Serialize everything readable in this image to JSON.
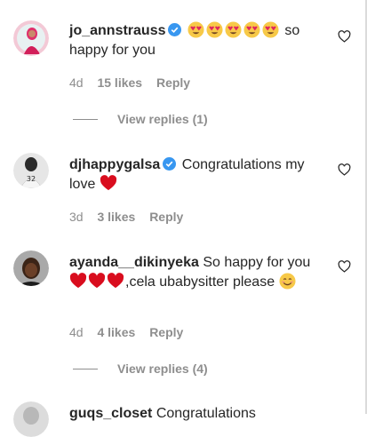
{
  "comments": [
    {
      "username": "jo_annstrauss",
      "verified": true,
      "text": "so happy for you",
      "emoji_count": 5,
      "time": "4d",
      "likes": "15 likes",
      "reply": "Reply",
      "view_replies": "View replies (1)"
    },
    {
      "username": "djhappygalsa",
      "verified": true,
      "text": "Congratulations my love",
      "time": "3d",
      "likes": "3 likes",
      "reply": "Reply"
    },
    {
      "username": "ayanda__dikinyeka",
      "verified": false,
      "text_1": "So happy for you",
      "text_2": ",cela ubabysitter please",
      "time": "4d",
      "likes": "4 likes",
      "reply": "Reply",
      "view_replies": "View replies (4)"
    },
    {
      "username": "guqs_closet",
      "text": "Congratulations"
    }
  ],
  "colors": {
    "text": "#262626",
    "muted": "#8e8e8e",
    "verified": "#3897f0",
    "heart": "#d90d1e"
  }
}
